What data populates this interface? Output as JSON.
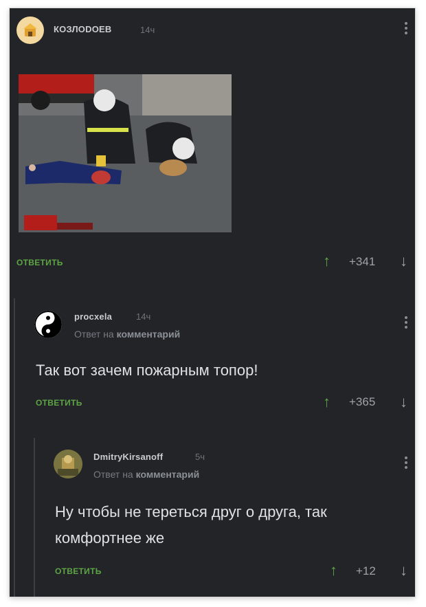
{
  "comments": [
    {
      "username": "КОЗЛODOEB",
      "time": "14ч",
      "reply_label": "ОТВЕТИТЬ",
      "score": "+341",
      "image_alt": "photo-firefighters-cpr"
    },
    {
      "username": "procxela",
      "time": "14ч",
      "sub_prefix": "Ответ на",
      "sub_link": "комментарий",
      "text": "Так вот зачем пожарным топор!",
      "reply_label": "ОТВЕТИТЬ",
      "score": "+365"
    },
    {
      "username": "DmitryKirsanoff",
      "time": "5ч",
      "sub_prefix": "Ответ на",
      "sub_link": "комментарий",
      "text_line1": "Ну чтобы не тереться друг о друга, так",
      "text_line2": "комфортнее же",
      "reply_label": "ОТВЕТИТЬ",
      "score": "+12"
    }
  ],
  "icons": {
    "up": "↑",
    "down": "↓"
  },
  "colors": {
    "background": "#222428",
    "accent_green": "#5ea545",
    "text": "#dfe1e4"
  }
}
